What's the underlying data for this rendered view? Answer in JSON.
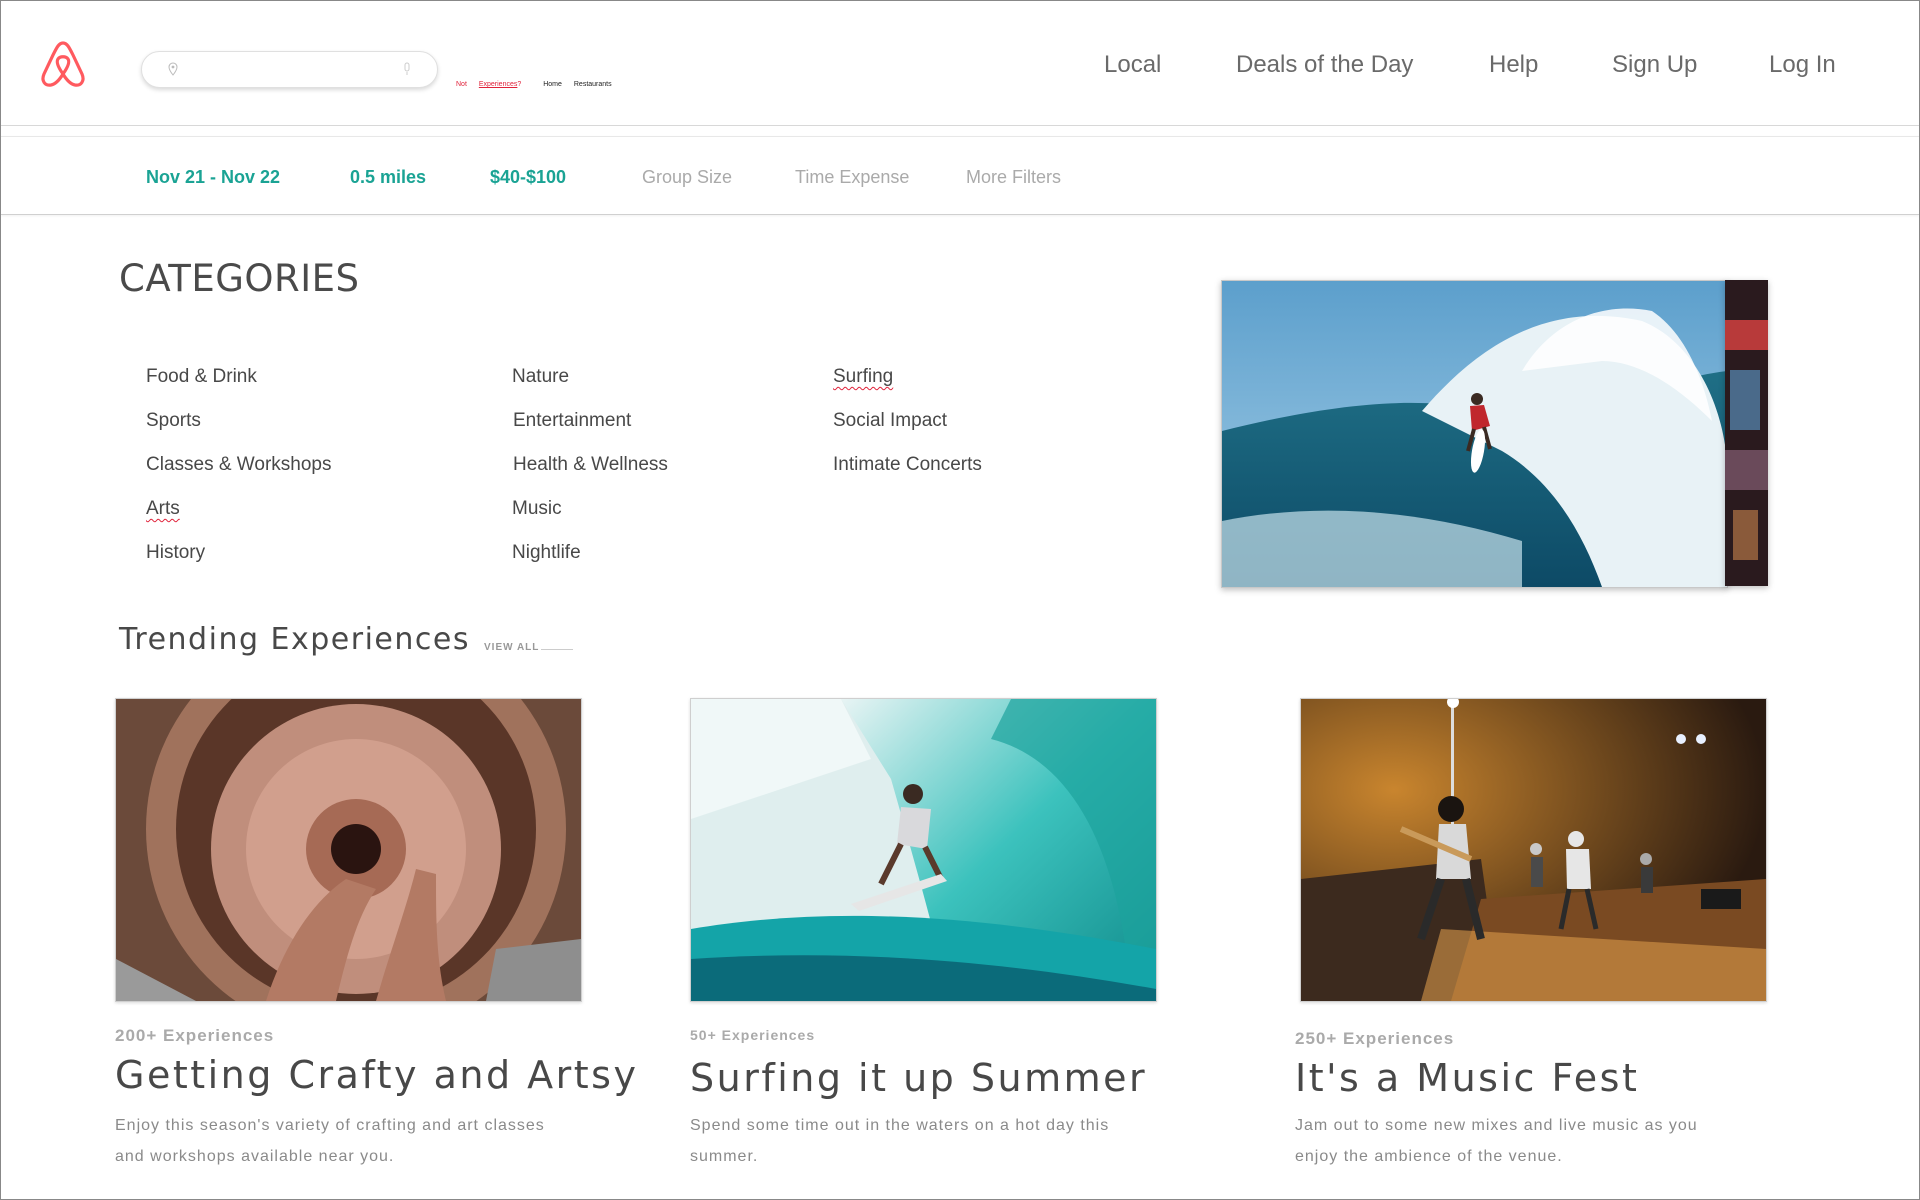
{
  "header": {
    "mini_links": {
      "prefix": "Not ",
      "experiences": "Experiences",
      "suffix": "?",
      "home": "Home",
      "restaurants": "Restaurants"
    },
    "nav": [
      "Local",
      "Deals of the Day",
      "Help",
      "Sign Up",
      "Log In"
    ],
    "search": {
      "placeholder": ""
    },
    "brand_color": "#FF5A5F"
  },
  "filters": {
    "dates": "Nov 21 - Nov 22",
    "distance": "0.5 miles",
    "price": "$40-$100",
    "group_size": "Group Size",
    "time_expense": "Time Expense",
    "more_filters": "More Filters",
    "active_color": "#1AA394"
  },
  "categories": {
    "title": "CATEGORIES",
    "col1": [
      "Food & Drink",
      "Sports",
      "Classes & Workshops",
      "Arts",
      "History"
    ],
    "col2": [
      "Nature",
      "Entertainment",
      "Health & Wellness",
      "Music",
      "Nightlife"
    ],
    "col3": [
      "Surfing",
      "Social Impact",
      "Intimate Concerts"
    ]
  },
  "trending": {
    "title": "Trending Experiences",
    "view_all": "VIEW ALL",
    "cards": [
      {
        "count": "200+ Experiences",
        "title": "Getting Crafty and Artsy",
        "desc": "Enjoy this season's variety of crafting and art classes and workshops available near you."
      },
      {
        "count": "50+ Experiences",
        "title": "Surfing it up Summer",
        "desc": "Spend some time out in the waters on a hot day this summer."
      },
      {
        "count": "250+ Experiences",
        "title": "It's a Music Fest",
        "desc": "Jam out to some new mixes and live music as you enjoy the ambience of the venue."
      }
    ]
  }
}
